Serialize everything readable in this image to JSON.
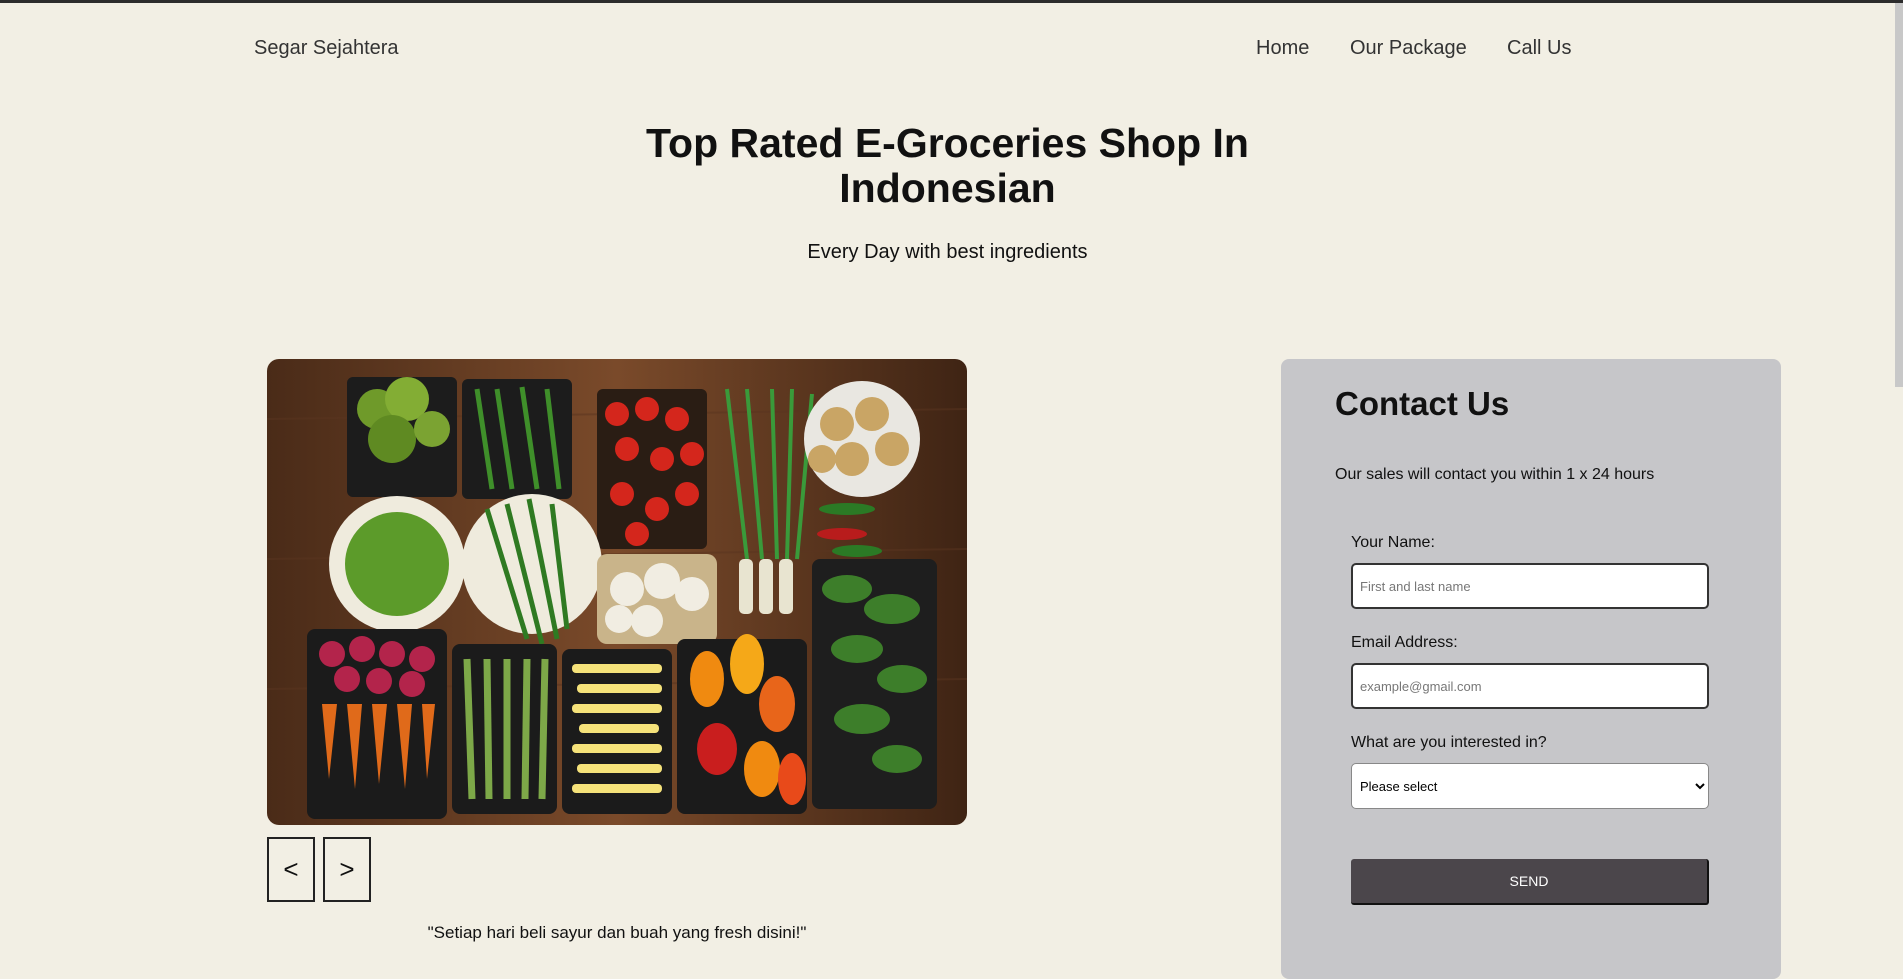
{
  "brand": "Segar Sejahtera",
  "nav": {
    "home": "Home",
    "package": "Our Package",
    "call": "Call Us"
  },
  "hero": {
    "title": "Top Rated E-Groceries Shop In Indonesian",
    "subtitle": "Every Day with best ingredients"
  },
  "slider": {
    "prev": "<",
    "next": ">",
    "caption": "\"Setiap hari beli sayur dan buah yang fresh disini!\""
  },
  "contact": {
    "title": "Contact Us",
    "description": "Our sales will contact you within 1 x 24 hours",
    "name_label": "Your Name:",
    "name_placeholder": "First and last name",
    "email_label": "Email Address:",
    "email_placeholder": "example@gmail.com",
    "interest_label": "What are you interested in?",
    "interest_selected": "Please select",
    "send": "SEND"
  },
  "colors": {
    "background": "#f2efe4",
    "panel": "#c6c6c9",
    "button": "#4b464b"
  }
}
